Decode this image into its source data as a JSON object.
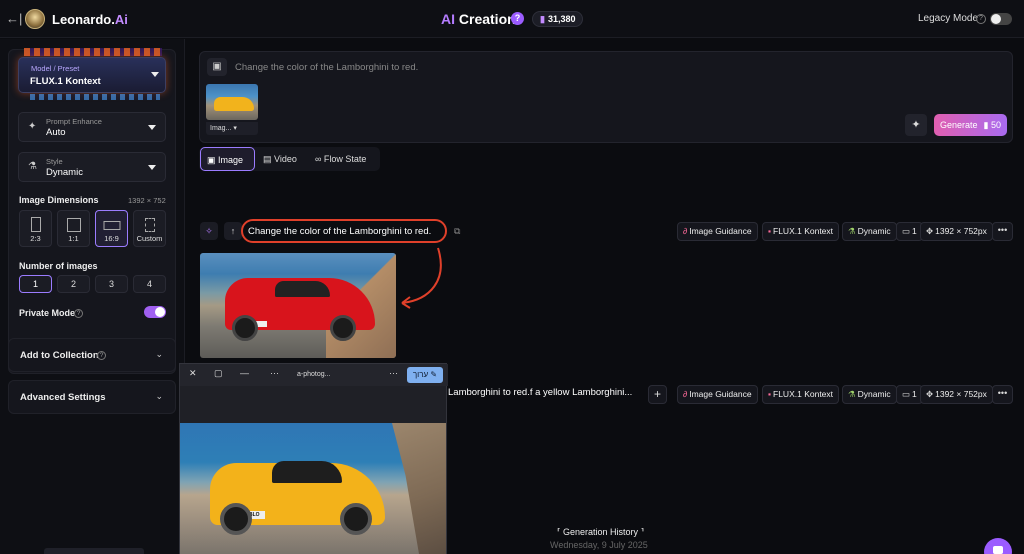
{
  "header": {
    "back_icon": "←|",
    "brand_main": "Leonardo.",
    "brand_ai": "Ai",
    "title_ai": "AI",
    "title_rest": " Creation",
    "help_icon": "?",
    "tokens": "31,380",
    "legacy_label": "Legacy Mode",
    "legacy_on": false
  },
  "sidebar": {
    "model": {
      "label": "Model / Preset",
      "value": "FLUX.1 Kontext"
    },
    "prompt_enhance": {
      "label": "Prompt Enhance",
      "value": "Auto",
      "icon": "✦"
    },
    "style": {
      "label": "Style",
      "value": "Dynamic",
      "icon": "⚗"
    },
    "dimensions": {
      "title": "Image Dimensions",
      "value": "1392 × 752",
      "options": [
        "2:3",
        "1:1",
        "16:9",
        "Custom"
      ],
      "selected": "16:9"
    },
    "num_images": {
      "title": "Number of images",
      "options": [
        "1",
        "2",
        "3",
        "4"
      ],
      "selected": "1"
    },
    "private_mode": {
      "label": "Private Mode",
      "on": true
    },
    "add_collection": "Add to Collection",
    "advanced": "Advanced Settings"
  },
  "prompt": {
    "text": "Change the color of the Lamborghini to red.",
    "thumb_label": "Imag...",
    "generate_label": "Generate",
    "generate_cost": "50"
  },
  "modes": [
    "Image",
    "Video",
    "Flow State"
  ],
  "generations": [
    {
      "prompt": "Change the color of the Lamborghini to red.",
      "tags": [
        "Image Guidance",
        "FLUX.1 Kontext",
        "Dynamic",
        "1",
        "1392 × 752px"
      ]
    },
    {
      "prompt": "Lamborghini to red.f a yellow Lamborghini...",
      "tags": [
        "Image Guidance",
        "FLUX.1 Kontext",
        "Dynamic",
        "1",
        "1392 × 752px"
      ]
    }
  ],
  "viewer": {
    "filename": "a-photog...",
    "edit_label": "ערוך",
    "plate": "DIABLO"
  },
  "history": {
    "title": "Generation History",
    "date": "Wednesday, 9 July 2025"
  },
  "colors": {
    "accent": "#9b5cff",
    "highlight": "#e0402a",
    "generate_from": "#e05fb0",
    "generate_to": "#a96bf0"
  }
}
